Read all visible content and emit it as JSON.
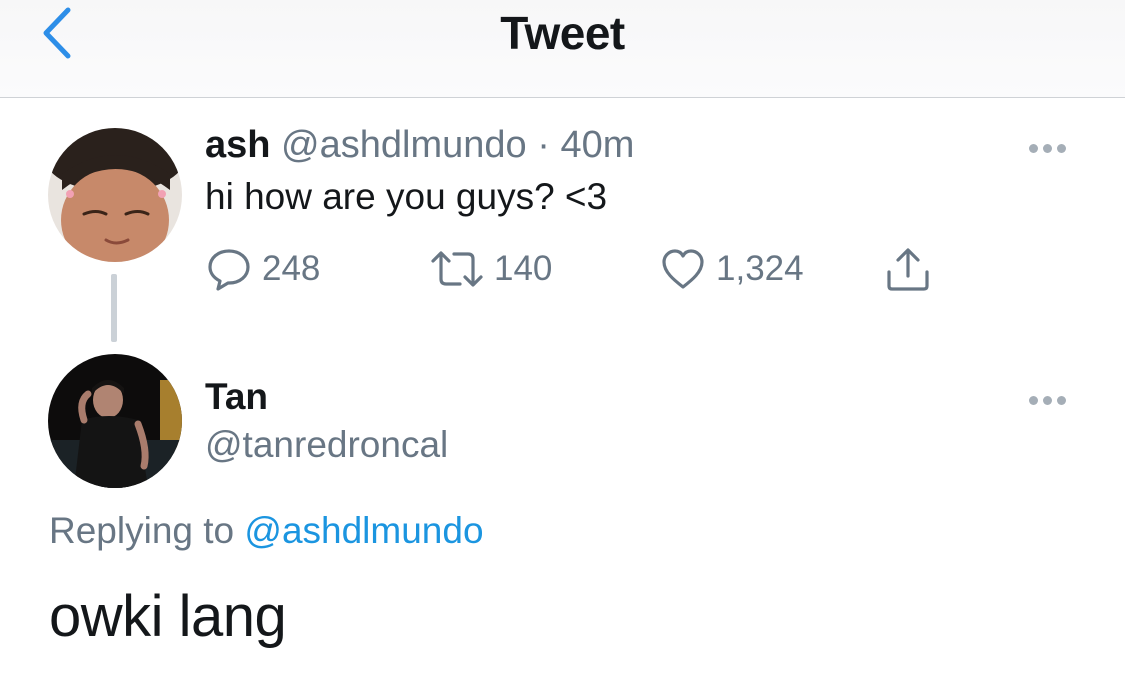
{
  "header": {
    "title": "Tweet",
    "back_icon": "chevron-left-icon",
    "accent_color": "#1b95e0"
  },
  "tweet": {
    "display_name": "ash",
    "handle": "@ashdlmundo",
    "separator": "·",
    "time": "40m",
    "text": "hi how are you guys? <3",
    "more_icon": "more-horizontal-icon",
    "actions": {
      "reply_count": "248",
      "retweet_count": "140",
      "like_count": "1,324"
    }
  },
  "reply": {
    "display_name": "Tan",
    "handle": "@tanredroncal",
    "replying_prefix": "Replying to",
    "replying_to": "@ashdlmundo",
    "text": "owki lang",
    "more_icon": "more-horizontal-icon"
  }
}
